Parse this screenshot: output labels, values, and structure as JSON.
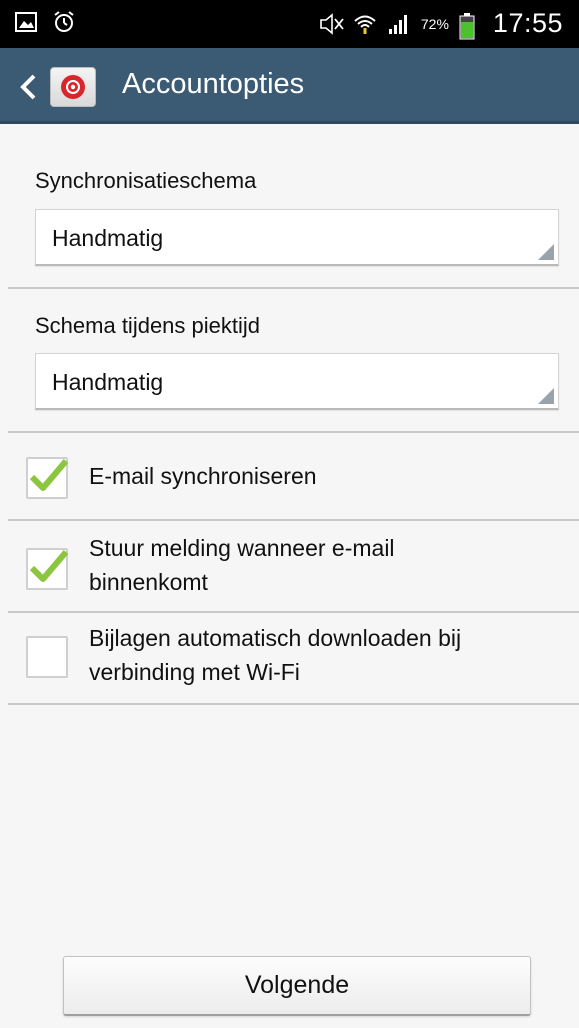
{
  "status_bar": {
    "battery_percent": "72%",
    "time": "17:55",
    "icons": [
      "image-icon",
      "alarm-icon",
      "mute-icon",
      "wifi-icon",
      "signal-icon",
      "battery-icon"
    ]
  },
  "action_bar": {
    "title": "Accountopties",
    "background_color": "#3b5a73"
  },
  "sync_schedule": {
    "label": "Synchronisatieschema",
    "value": "Handmatig"
  },
  "peak_schedule": {
    "label": "Schema tijdens piektijd",
    "value": "Handmatig"
  },
  "checkboxes": [
    {
      "label_line1": "E-mail synchroniseren",
      "label_line2": "",
      "checked": true
    },
    {
      "label_line1": "Stuur melding wanneer e-mail",
      "label_line2": "binnenkomt",
      "checked": true
    },
    {
      "label_line1": "Bijlagen automatisch downloaden bij",
      "label_line2": "verbinding met Wi-Fi",
      "checked": false
    }
  ],
  "next_button": {
    "label": "Volgende"
  },
  "colors": {
    "accent_check": "#8cc63f"
  }
}
